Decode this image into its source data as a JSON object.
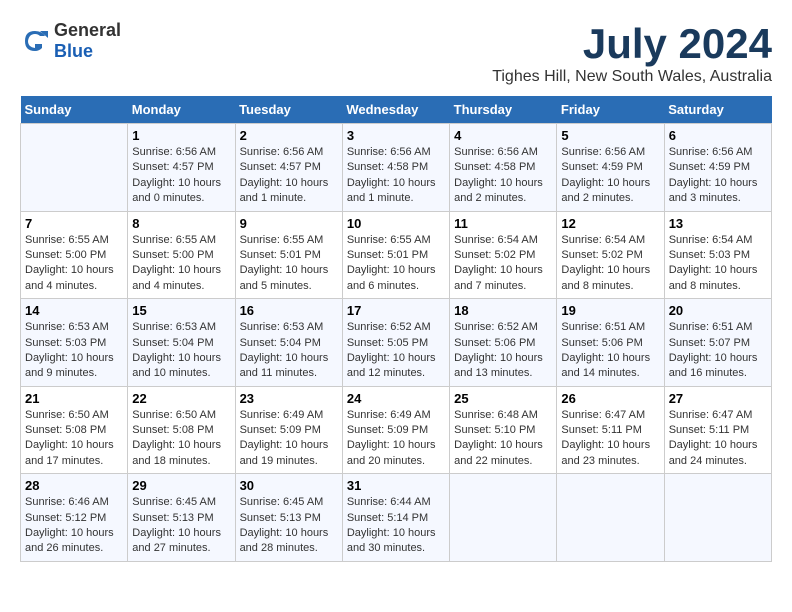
{
  "header": {
    "logo_general": "General",
    "logo_blue": "Blue",
    "title": "July 2024",
    "location": "Tighes Hill, New South Wales, Australia"
  },
  "calendar": {
    "days_of_week": [
      "Sunday",
      "Monday",
      "Tuesday",
      "Wednesday",
      "Thursday",
      "Friday",
      "Saturday"
    ],
    "weeks": [
      [
        {
          "day": "",
          "info": ""
        },
        {
          "day": "1",
          "info": "Sunrise: 6:56 AM\nSunset: 4:57 PM\nDaylight: 10 hours\nand 0 minutes."
        },
        {
          "day": "2",
          "info": "Sunrise: 6:56 AM\nSunset: 4:57 PM\nDaylight: 10 hours\nand 1 minute."
        },
        {
          "day": "3",
          "info": "Sunrise: 6:56 AM\nSunset: 4:58 PM\nDaylight: 10 hours\nand 1 minute."
        },
        {
          "day": "4",
          "info": "Sunrise: 6:56 AM\nSunset: 4:58 PM\nDaylight: 10 hours\nand 2 minutes."
        },
        {
          "day": "5",
          "info": "Sunrise: 6:56 AM\nSunset: 4:59 PM\nDaylight: 10 hours\nand 2 minutes."
        },
        {
          "day": "6",
          "info": "Sunrise: 6:56 AM\nSunset: 4:59 PM\nDaylight: 10 hours\nand 3 minutes."
        }
      ],
      [
        {
          "day": "7",
          "info": "Sunrise: 6:55 AM\nSunset: 5:00 PM\nDaylight: 10 hours\nand 4 minutes."
        },
        {
          "day": "8",
          "info": "Sunrise: 6:55 AM\nSunset: 5:00 PM\nDaylight: 10 hours\nand 4 minutes."
        },
        {
          "day": "9",
          "info": "Sunrise: 6:55 AM\nSunset: 5:01 PM\nDaylight: 10 hours\nand 5 minutes."
        },
        {
          "day": "10",
          "info": "Sunrise: 6:55 AM\nSunset: 5:01 PM\nDaylight: 10 hours\nand 6 minutes."
        },
        {
          "day": "11",
          "info": "Sunrise: 6:54 AM\nSunset: 5:02 PM\nDaylight: 10 hours\nand 7 minutes."
        },
        {
          "day": "12",
          "info": "Sunrise: 6:54 AM\nSunset: 5:02 PM\nDaylight: 10 hours\nand 8 minutes."
        },
        {
          "day": "13",
          "info": "Sunrise: 6:54 AM\nSunset: 5:03 PM\nDaylight: 10 hours\nand 8 minutes."
        }
      ],
      [
        {
          "day": "14",
          "info": "Sunrise: 6:53 AM\nSunset: 5:03 PM\nDaylight: 10 hours\nand 9 minutes."
        },
        {
          "day": "15",
          "info": "Sunrise: 6:53 AM\nSunset: 5:04 PM\nDaylight: 10 hours\nand 10 minutes."
        },
        {
          "day": "16",
          "info": "Sunrise: 6:53 AM\nSunset: 5:04 PM\nDaylight: 10 hours\nand 11 minutes."
        },
        {
          "day": "17",
          "info": "Sunrise: 6:52 AM\nSunset: 5:05 PM\nDaylight: 10 hours\nand 12 minutes."
        },
        {
          "day": "18",
          "info": "Sunrise: 6:52 AM\nSunset: 5:06 PM\nDaylight: 10 hours\nand 13 minutes."
        },
        {
          "day": "19",
          "info": "Sunrise: 6:51 AM\nSunset: 5:06 PM\nDaylight: 10 hours\nand 14 minutes."
        },
        {
          "day": "20",
          "info": "Sunrise: 6:51 AM\nSunset: 5:07 PM\nDaylight: 10 hours\nand 16 minutes."
        }
      ],
      [
        {
          "day": "21",
          "info": "Sunrise: 6:50 AM\nSunset: 5:08 PM\nDaylight: 10 hours\nand 17 minutes."
        },
        {
          "day": "22",
          "info": "Sunrise: 6:50 AM\nSunset: 5:08 PM\nDaylight: 10 hours\nand 18 minutes."
        },
        {
          "day": "23",
          "info": "Sunrise: 6:49 AM\nSunset: 5:09 PM\nDaylight: 10 hours\nand 19 minutes."
        },
        {
          "day": "24",
          "info": "Sunrise: 6:49 AM\nSunset: 5:09 PM\nDaylight: 10 hours\nand 20 minutes."
        },
        {
          "day": "25",
          "info": "Sunrise: 6:48 AM\nSunset: 5:10 PM\nDaylight: 10 hours\nand 22 minutes."
        },
        {
          "day": "26",
          "info": "Sunrise: 6:47 AM\nSunset: 5:11 PM\nDaylight: 10 hours\nand 23 minutes."
        },
        {
          "day": "27",
          "info": "Sunrise: 6:47 AM\nSunset: 5:11 PM\nDaylight: 10 hours\nand 24 minutes."
        }
      ],
      [
        {
          "day": "28",
          "info": "Sunrise: 6:46 AM\nSunset: 5:12 PM\nDaylight: 10 hours\nand 26 minutes."
        },
        {
          "day": "29",
          "info": "Sunrise: 6:45 AM\nSunset: 5:13 PM\nDaylight: 10 hours\nand 27 minutes."
        },
        {
          "day": "30",
          "info": "Sunrise: 6:45 AM\nSunset: 5:13 PM\nDaylight: 10 hours\nand 28 minutes."
        },
        {
          "day": "31",
          "info": "Sunrise: 6:44 AM\nSunset: 5:14 PM\nDaylight: 10 hours\nand 30 minutes."
        },
        {
          "day": "",
          "info": ""
        },
        {
          "day": "",
          "info": ""
        },
        {
          "day": "",
          "info": ""
        }
      ]
    ]
  }
}
